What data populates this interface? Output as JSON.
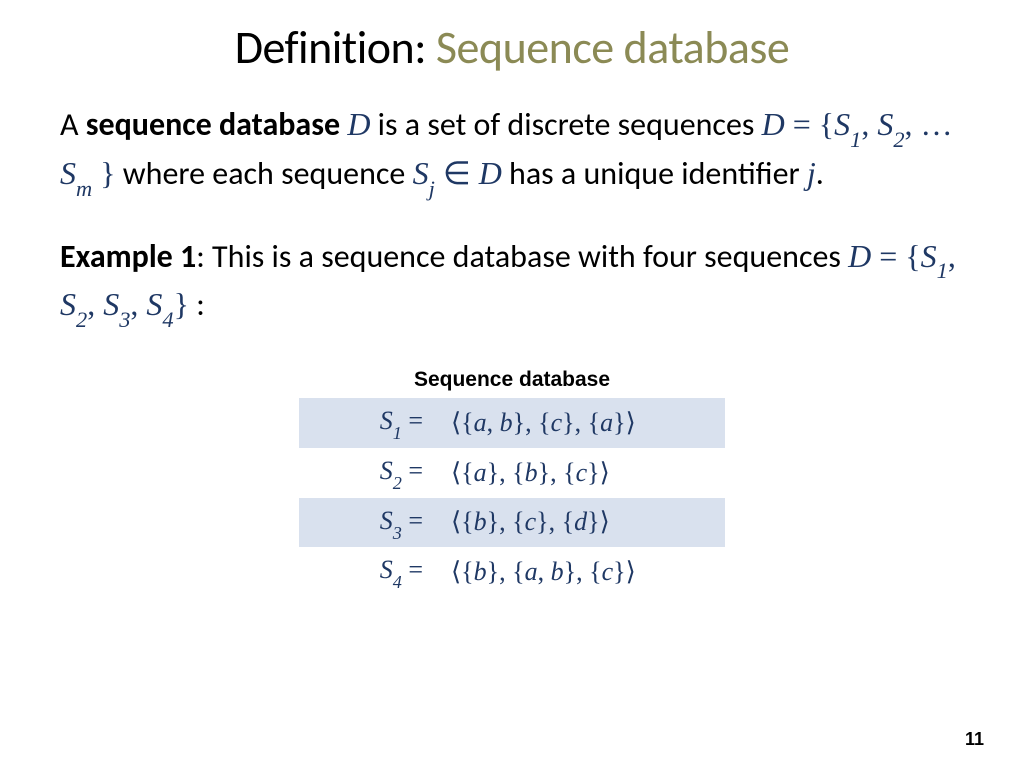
{
  "title": {
    "prefix": "Definition: ",
    "accent": "Sequence database"
  },
  "para1": {
    "t1": "A ",
    "bold": "sequence database",
    "t2": " ",
    "m1": "D",
    "t3": " is a set of discrete sequences ",
    "m2": "D = {S₁, S₂, … Sₘ }",
    "t4": " where each sequence ",
    "m3": "Sⱼ ∈ D",
    "t5": " has a unique identifier ",
    "m4": "j",
    "t6": "."
  },
  "para2": {
    "bold": "Example 1",
    "t1": ": This is a sequence database with four sequences ",
    "m1": "D = {S₁, S₂, S₃, S₄}",
    "t2": " :"
  },
  "table": {
    "caption": "Sequence database",
    "rows": [
      {
        "label": "S₁ =",
        "value": "⟨{a, b}, {c}, {a}⟩"
      },
      {
        "label": "S₂ =",
        "value": "⟨{a}, {b}, {c}⟩"
      },
      {
        "label": "S₃ =",
        "value": "⟨{b}, {c}, {d}⟩"
      },
      {
        "label": "S₄ =",
        "value": "⟨{b}, {a, b}, {c}⟩"
      }
    ]
  },
  "page_number": "11"
}
